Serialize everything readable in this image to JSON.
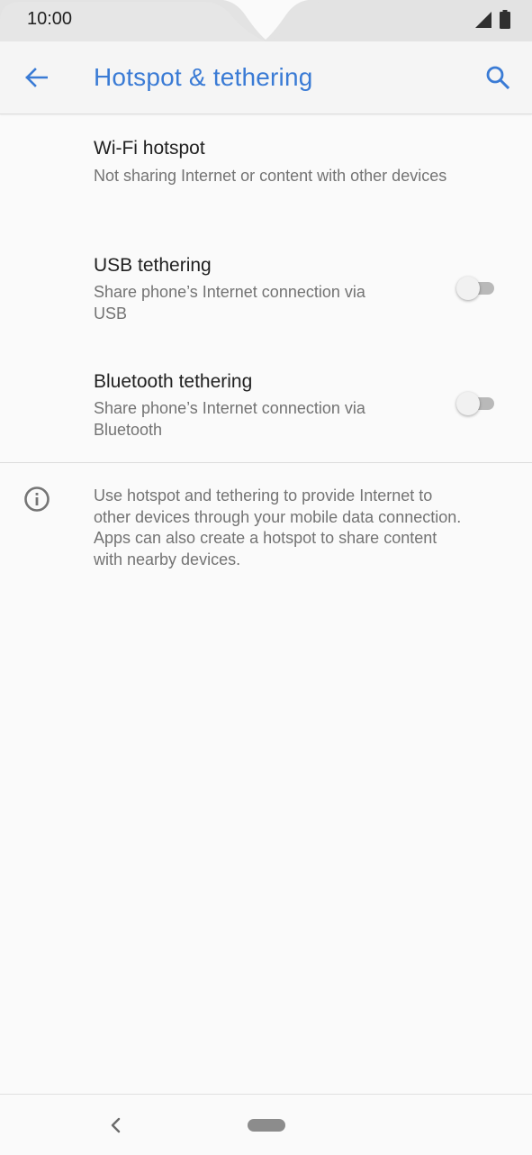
{
  "status_bar": {
    "time": "10:00",
    "icons": [
      "signal-icon",
      "battery-icon"
    ]
  },
  "app_bar": {
    "title": "Hotspot & tethering",
    "back_icon": "arrow-left-icon",
    "search_icon": "search-icon",
    "accent_color": "#3a7bd5"
  },
  "items": [
    {
      "title": "Wi-Fi hotspot",
      "subtitle": "Not sharing Internet or content with other devices",
      "has_toggle": false
    },
    {
      "title": "USB tethering",
      "subtitle_line1": "Share phone’s Internet connection via",
      "subtitle_line2": "USB",
      "has_toggle": true,
      "toggle_on": false
    },
    {
      "title": "Bluetooth tethering",
      "subtitle_line1": "Share phone’s Internet connection via",
      "subtitle_line2": "Bluetooth",
      "has_toggle": true,
      "toggle_on": false
    }
  ],
  "info": {
    "icon": "info-icon",
    "lines": [
      "Use hotspot and tethering to provide Internet to",
      "other devices through your mobile data connection.",
      "Apps can also create a hotspot to share content",
      "with nearby devices."
    ]
  },
  "nav_bar": {
    "back_icon": "nav-back-icon",
    "home_icon": "home-pill-icon"
  }
}
